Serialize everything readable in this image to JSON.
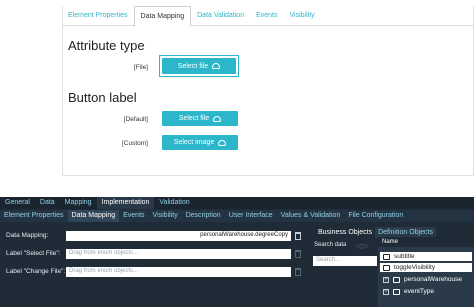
{
  "preview": {
    "tabs": [
      "Element Properties",
      "Data Mapping",
      "Data Validation",
      "Events",
      "Visibility"
    ],
    "active_tab": "Data Mapping",
    "attribute_type_title": "Attribute type",
    "file_label": "[File]",
    "select_file_label": "Select file",
    "button_label_title": "Button label",
    "default_label": "[Default]",
    "default_button": "Select file",
    "custom_label": "[Custom]",
    "custom_button": "Select image"
  },
  "editor": {
    "tabs_level1": [
      "General",
      "Data",
      "Mapping",
      "Implementation",
      "Validation"
    ],
    "active_level1": "Implementation",
    "tabs_level2": [
      "Element Properties",
      "Data Mapping",
      "Events",
      "Visibility",
      "Description",
      "User Interface",
      "Values & Validation",
      "File Configuration"
    ],
    "active_level2": "Data Mapping",
    "fields": {
      "data_mapping_label": "Data Mapping:",
      "data_mapping_value": "personalWarehouse.degreeCopy",
      "select_file_label": "Label \"Select File\":",
      "select_file_placeholder": "Drag from enum objects...",
      "change_file_label": "Label \"Change File\":",
      "change_file_placeholder": "Drag from enum objects..."
    },
    "right_panel": {
      "tabs": [
        "Business Objects",
        "Definition Objects"
      ],
      "search_label": "Search data",
      "search_placeholder": "Search...",
      "column_header": "Name",
      "items": [
        {
          "label": "subtitle",
          "selected": true
        },
        {
          "label": "toggleVisibility",
          "selected": true
        },
        {
          "label": "personalWarehouse",
          "selected": false
        },
        {
          "label": "eventType",
          "selected": false
        }
      ]
    }
  },
  "colors": {
    "accent": "#2bb7c9",
    "dark_bg": "#1f2b37"
  }
}
